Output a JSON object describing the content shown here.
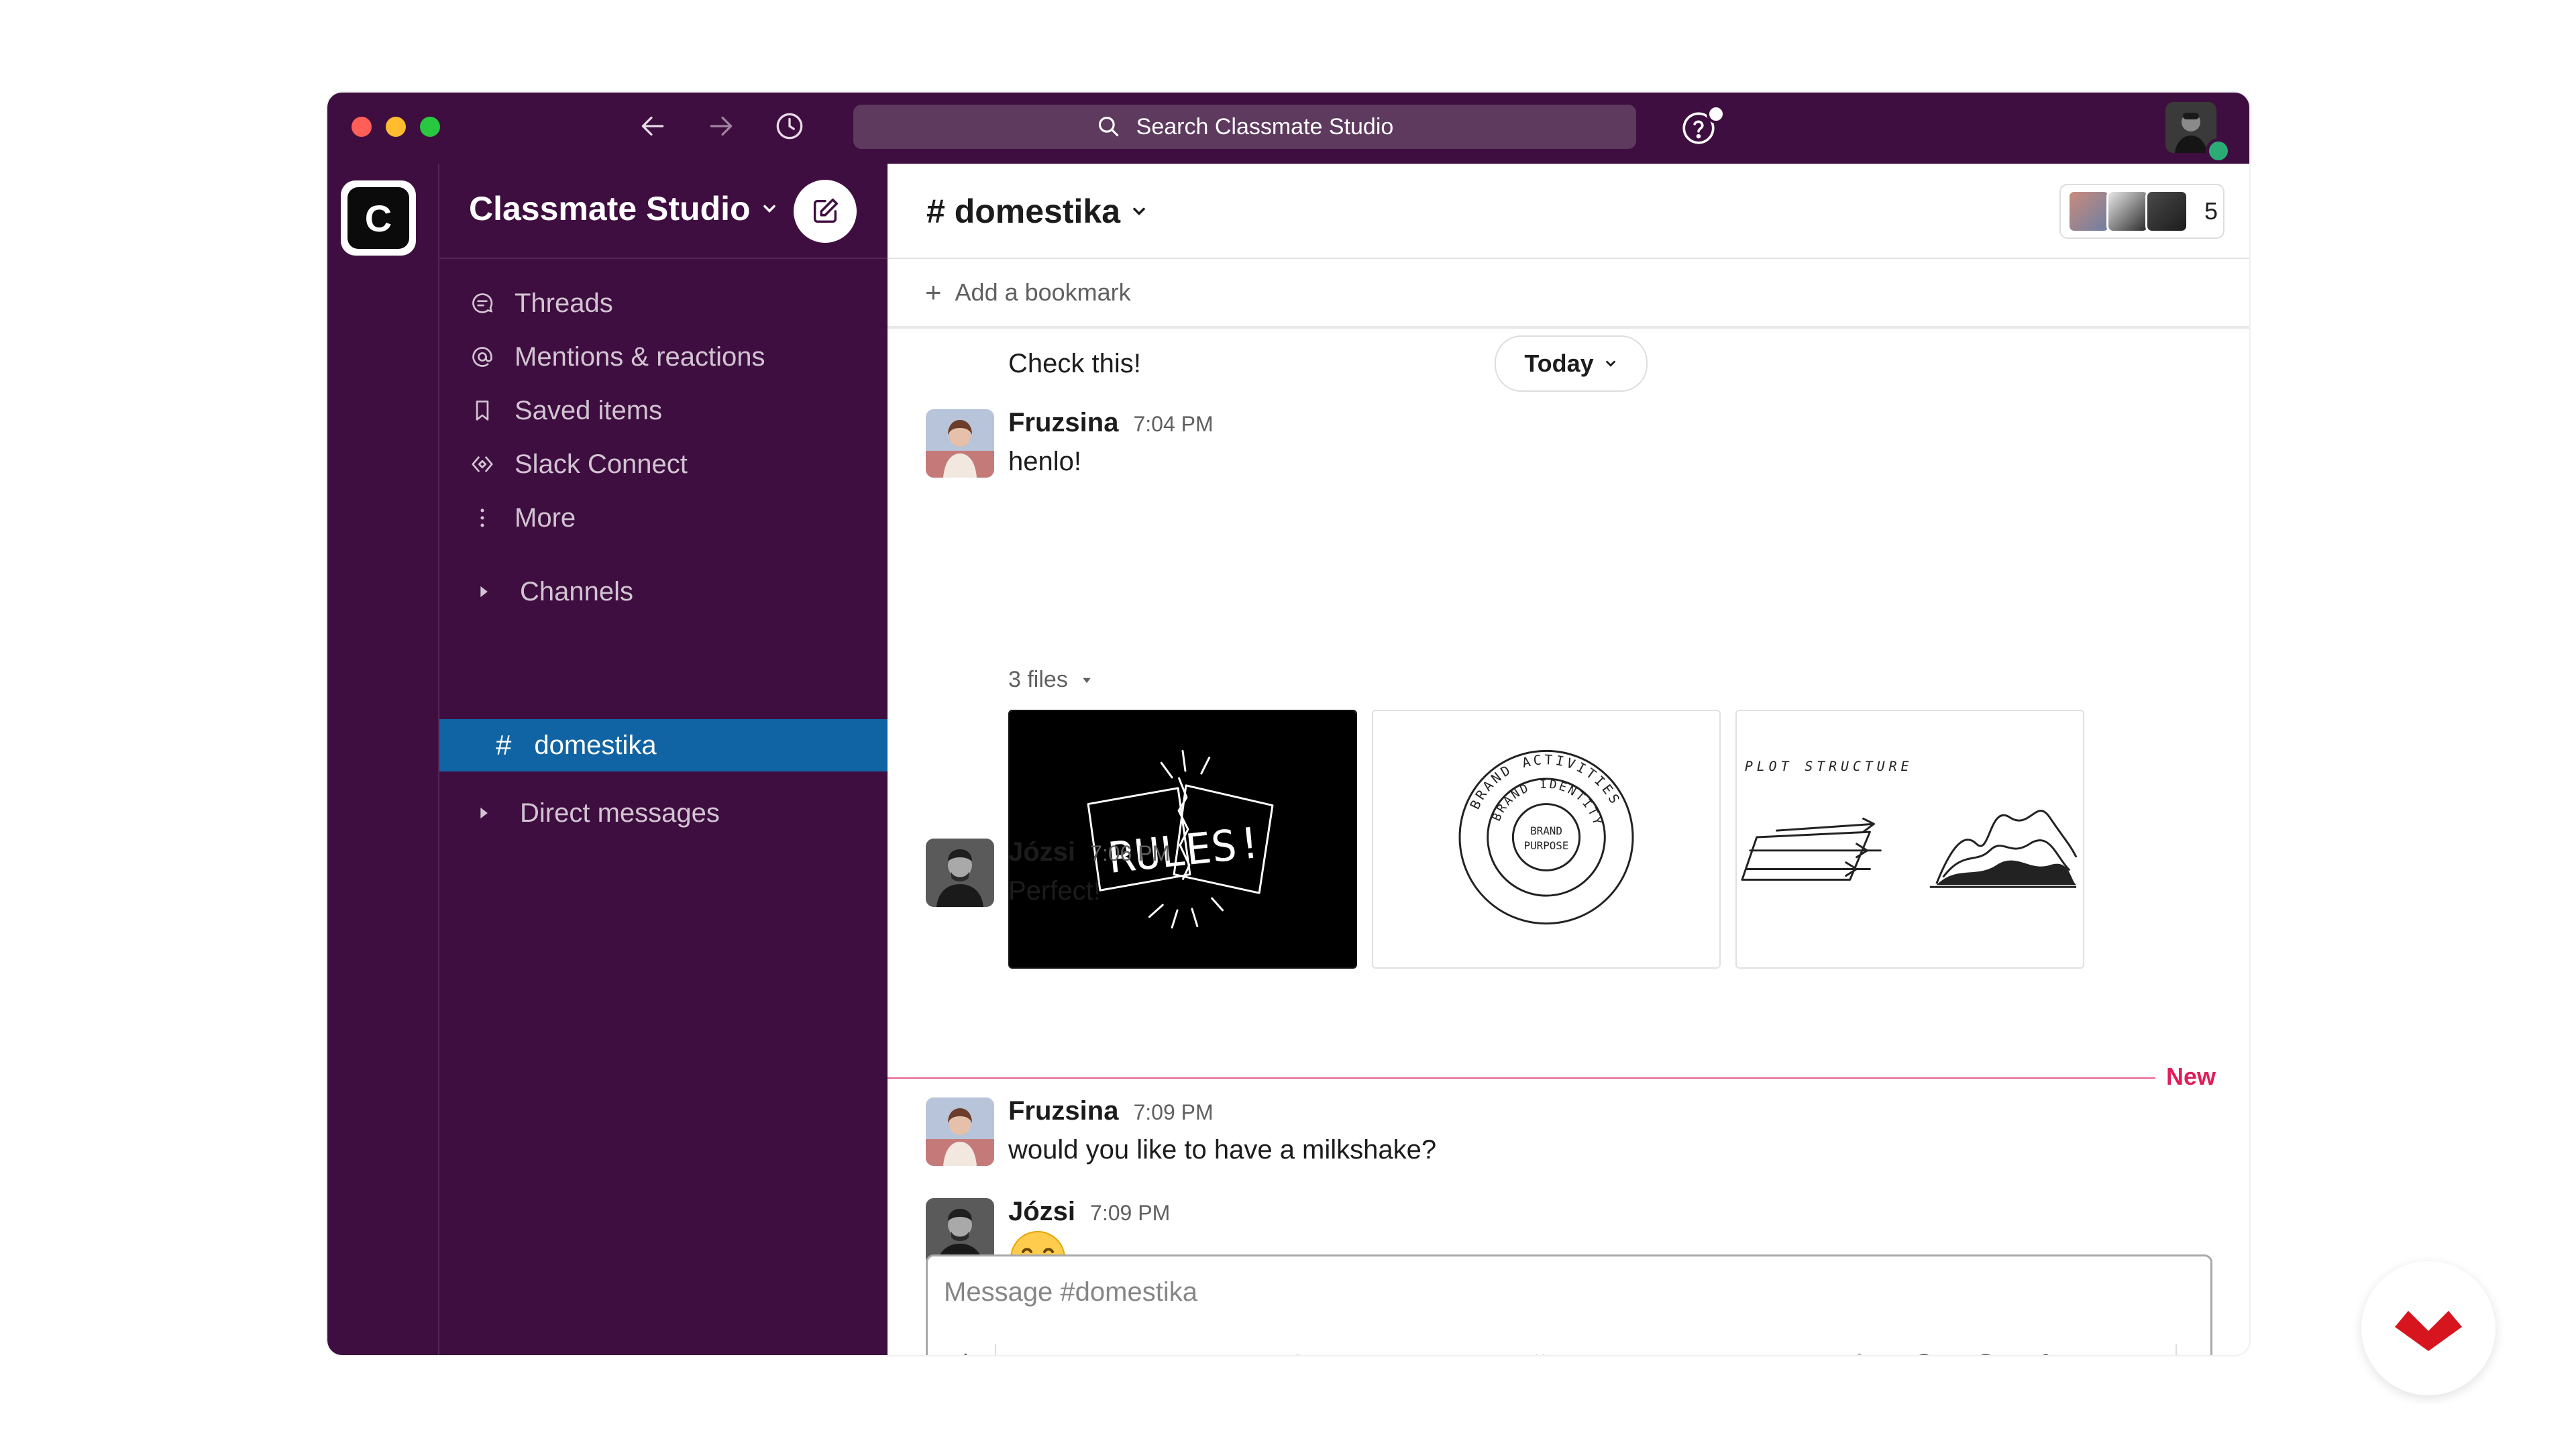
{
  "window": {
    "search_placeholder": "Search Classmate Studio"
  },
  "workspace": {
    "initial": "C",
    "name": "Classmate Studio"
  },
  "sidebar": {
    "items": [
      {
        "label": "Threads",
        "icon": "threads-icon"
      },
      {
        "label": "Mentions & reactions",
        "icon": "at-icon"
      },
      {
        "label": "Saved items",
        "icon": "bookmark-icon"
      },
      {
        "label": "Slack Connect",
        "icon": "connect-icon"
      },
      {
        "label": "More",
        "icon": "more-vertical-icon"
      }
    ],
    "channels_label": "Channels",
    "active_channel": "domestika",
    "dm_label": "Direct messages"
  },
  "channel": {
    "title": "# domestika",
    "member_count": "5",
    "add_bookmark": "Add a bookmark"
  },
  "messages": {
    "top_text": "Check this!",
    "date_pill": "Today",
    "list": [
      {
        "author": "Fruzsina",
        "time": "7:04 PM",
        "text": "henlo!"
      },
      {
        "author": "Józsi",
        "time": "7:06 PM",
        "text": "Perfect!"
      },
      {
        "author": "Fruzsina",
        "time": "7:09 PM",
        "text": "would you like to have a milkshake?"
      },
      {
        "author": "Józsi",
        "time": "7:09 PM",
        "text": ""
      }
    ],
    "files_label": "3 files",
    "new_label": "New",
    "thumb_texts": {
      "rules": "RULES!",
      "plot": "PLOT STRUCTURE",
      "ring_outer": "BRAND ACTIVITIES",
      "ring_mid": "BRAND IDENTITY",
      "ring_inner1": "BRAND",
      "ring_inner2": "PURPOSE"
    }
  },
  "composer": {
    "placeholder": "Message #domestika",
    "format_label": "Aa"
  },
  "colors": {
    "aubergine": "#3f0e40",
    "active_blue": "#1164a3",
    "new_red": "#e01e5a"
  }
}
